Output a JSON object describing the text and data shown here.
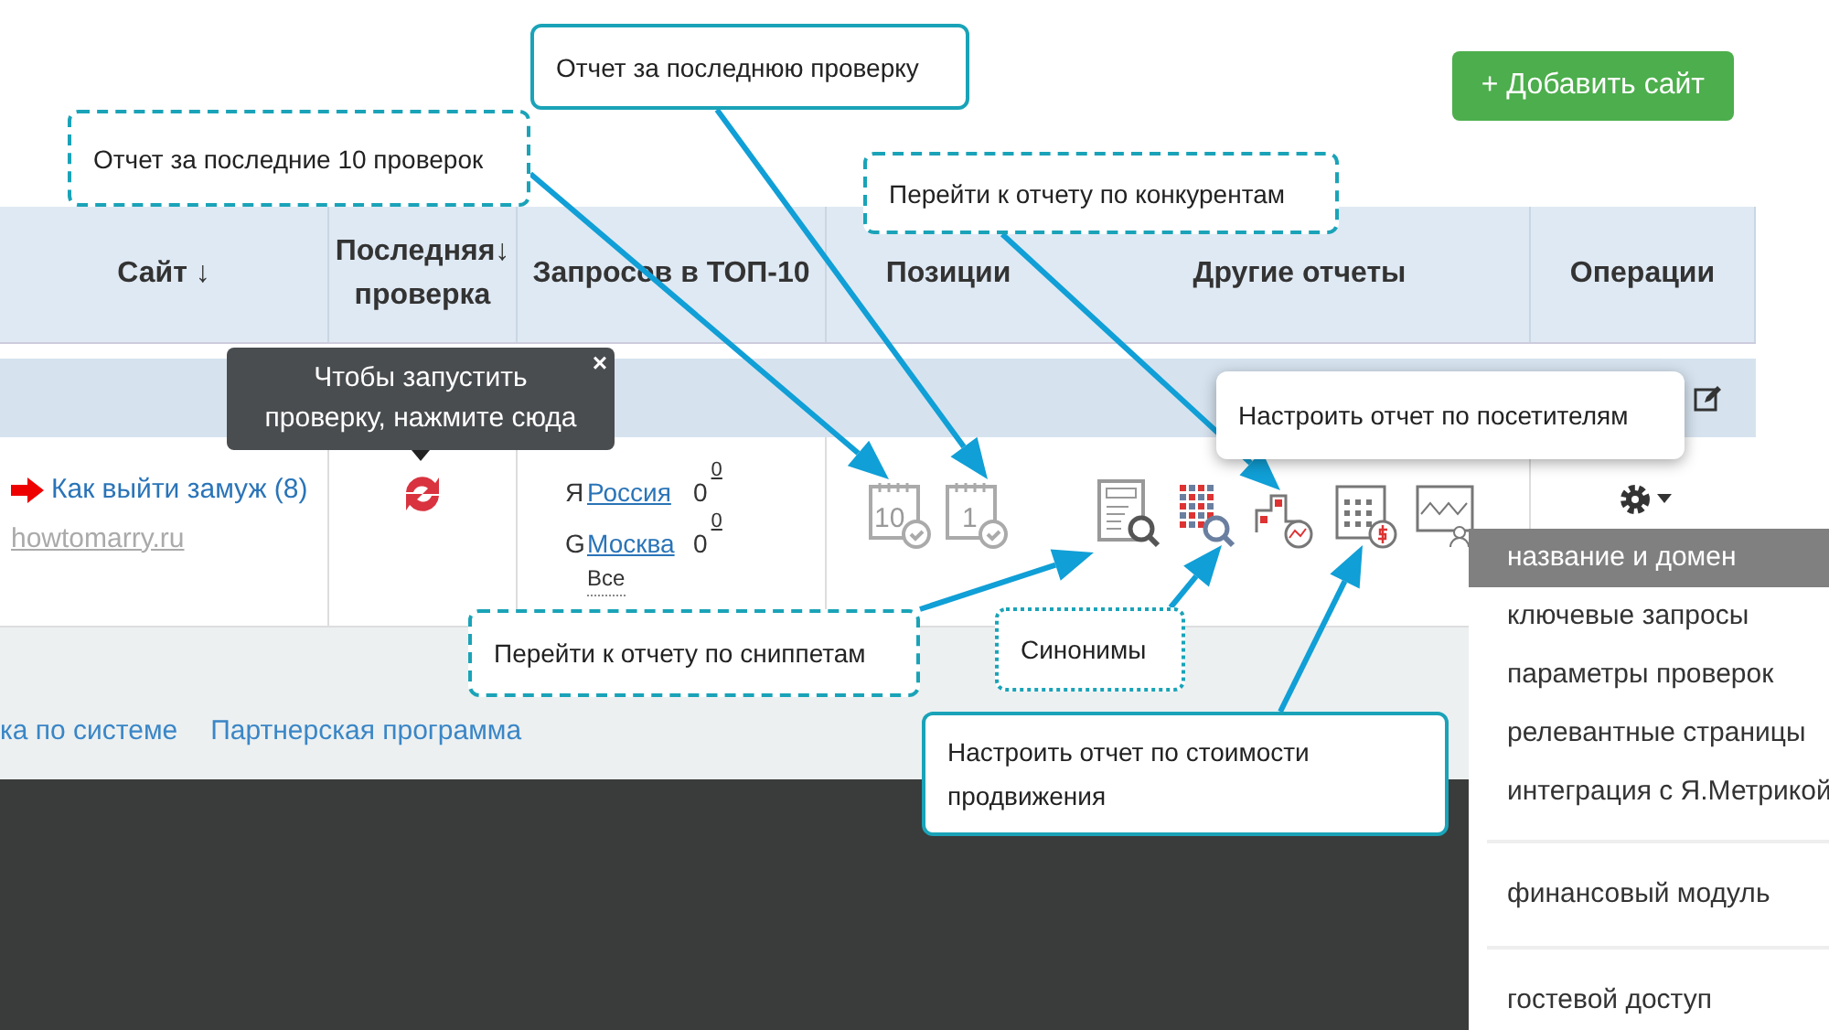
{
  "add_site_button": "+ Добавить сайт",
  "table": {
    "columns": [
      "Сайт ↓",
      "Последняя↓ проверка",
      "Запросов в ТОП-10",
      "Позиции",
      "Другие отчеты",
      "Операции"
    ],
    "row": {
      "site_name": "Как выйти замуж (8)",
      "domain": "howtomarry.ru",
      "engines": [
        {
          "letter": "Я",
          "region": "Россия",
          "count": "0",
          "delta": "0"
        },
        {
          "letter": "G",
          "region": "Москва",
          "count": "0",
          "delta": "0"
        }
      ],
      "all_link": "Все"
    },
    "position_icons": [
      "10",
      "1"
    ]
  },
  "footer_links": [
    "ка по системе",
    "Партнерская программа"
  ],
  "tooltip": {
    "text": "Чтобы запустить проверку, нажмите сюда",
    "close": "×"
  },
  "callouts": [
    {
      "kind": "dashed",
      "text": "Отчет за последние 10 проверок"
    },
    {
      "kind": "solid",
      "text": "Отчет за последнюю проверку"
    },
    {
      "kind": "dashed",
      "text": "Перейти к отчету по конкурентам"
    },
    {
      "kind": "shadow",
      "text": "Настроить отчет по посетителям"
    },
    {
      "kind": "dashed",
      "text": "Перейти к отчету по сниппетам"
    },
    {
      "kind": "dotted",
      "text": "Синонимы"
    },
    {
      "kind": "solid",
      "text": "Настроить отчет по стоимости продвижения"
    }
  ],
  "menu": {
    "groups": [
      [
        {
          "label": "название и домен",
          "selected": true
        },
        {
          "label": "ключевые запросы",
          "selected": false
        },
        {
          "label": "параметры проверок",
          "selected": false
        },
        {
          "label": "релевантные страницы",
          "selected": false
        },
        {
          "label": "интеграция с Я.Метрикой",
          "selected": false
        }
      ],
      [
        {
          "label": "финансовый модуль",
          "selected": false
        }
      ],
      [
        {
          "label": "гостевой доступ",
          "selected": false
        }
      ]
    ]
  }
}
